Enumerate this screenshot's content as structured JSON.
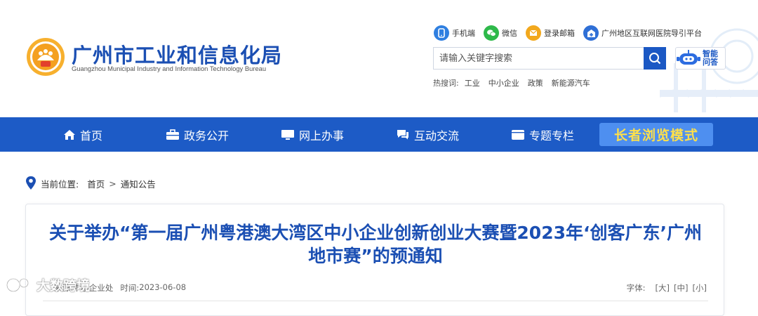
{
  "header": {
    "title_cn": "广州市工业和信息化局",
    "title_en": "Guangzhou Municipal Industry and Information Technology Bureau",
    "top_links": [
      {
        "label": "手机端",
        "icon": "mobile-icon",
        "color": "#2f7fe0"
      },
      {
        "label": "微信",
        "icon": "wechat-icon",
        "color": "#2eb94a"
      },
      {
        "label": "登录邮箱",
        "icon": "mail-icon",
        "color": "#f2a81d"
      },
      {
        "label": "广州地区互联网医院导引平台",
        "icon": "hospital-icon",
        "color": "#2f6fd6"
      }
    ],
    "search": {
      "placeholder": "请输入关键字搜索",
      "value": ""
    },
    "ai_button": {
      "line1": "智能",
      "line2": "问答"
    },
    "hot_search": {
      "label": "热搜词:",
      "items": [
        "工业",
        "中小企业",
        "政策",
        "新能源汽车"
      ]
    }
  },
  "nav": {
    "items": [
      {
        "label": "首页",
        "icon": "home-icon"
      },
      {
        "label": "政务公开",
        "icon": "briefcase-icon"
      },
      {
        "label": "网上办事",
        "icon": "monitor-icon"
      },
      {
        "label": "互动交流",
        "icon": "chat-icon"
      },
      {
        "label": "专题专栏",
        "icon": "folder-icon"
      }
    ],
    "elder_mode": "长者浏览模式"
  },
  "breadcrumb": {
    "prefix": "当前位置:",
    "items": [
      "首页",
      "通知公告"
    ],
    "sep": ">"
  },
  "article": {
    "title": "关于举办“第一届广州粤港澳大湾区中小企业创新创业大赛暨2023年‘创客广东’广州地市赛”的预通知",
    "source": "来源:中小企业处",
    "date_label": "时间:",
    "date": "2023-06-08",
    "font_size_label": "字体:",
    "font_sizes": [
      "[大]",
      "[中]",
      "[小]"
    ]
  },
  "watermark": "大数跨境",
  "colors": {
    "brand_blue": "#1d5bc6",
    "title_blue": "#1b4fb3",
    "elder_yellow": "#ffe04a"
  }
}
